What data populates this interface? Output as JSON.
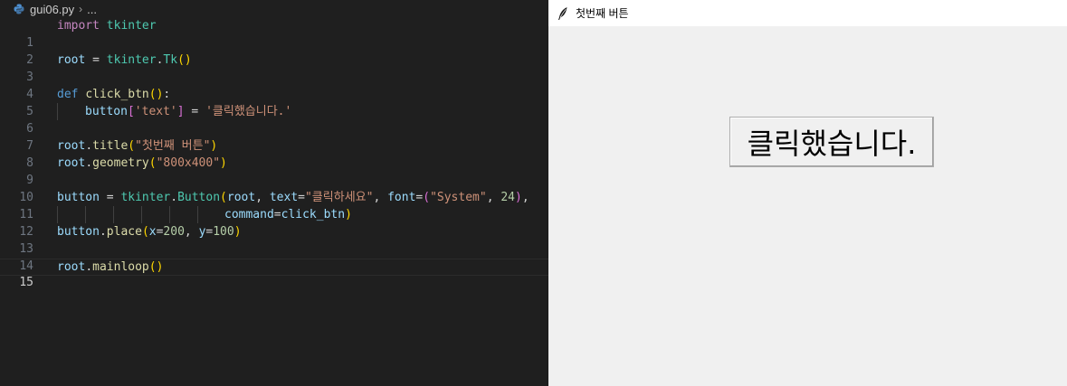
{
  "editor": {
    "breadcrumb": {
      "file": "gui06.py",
      "ellipsis": "..."
    },
    "current_line": 15,
    "line_numbers": [
      "1",
      "2",
      "3",
      "4",
      "5",
      "6",
      "7",
      "8",
      "9",
      "10",
      "11",
      "12",
      "13",
      "14",
      "15"
    ],
    "code": {
      "l1": {
        "kw": "import",
        "mod": "tkinter"
      },
      "l3": {
        "var": "root",
        "eq": " = ",
        "mod": "tkinter",
        "dot": ".",
        "cls": "Tk",
        "p": "()"
      },
      "l5": {
        "kw": "def",
        "fn": "click_btn",
        "p": "()",
        "colon": ":"
      },
      "l6": {
        "var": "button",
        "b1": "[",
        "key": "'text'",
        "b2": "]",
        "eq": " = ",
        "val": "'클릭했습니다.'"
      },
      "l8": {
        "var": "root",
        "dot": ".",
        "fn": "title",
        "p1": "(",
        "str": "\"첫번째 버튼\"",
        "p2": ")"
      },
      "l9": {
        "var": "root",
        "dot": ".",
        "fn": "geometry",
        "p1": "(",
        "str": "\"800x400\"",
        "p2": ")"
      },
      "l11": {
        "var": "button",
        "eq": " = ",
        "mod": "tkinter",
        "dot": ".",
        "cls": "Button",
        "p1": "(",
        "arg": "root",
        "comma": ", ",
        "kw": "text",
        "eqs": "=",
        "str": "\"클릭하세요\"",
        "comma2": ", ",
        "kw2": "font",
        "eqs2": "=",
        "t1": "(",
        "str2": "\"System\"",
        "comma3": ", ",
        "num": "24",
        "t2": ")",
        "comma4": ","
      },
      "l12": {
        "kw": "command",
        "eqs": "=",
        "val": "click_btn",
        "p2": ")"
      },
      "l13": {
        "var": "button",
        "dot": ".",
        "fn": "place",
        "p1": "(",
        "kx": "x",
        "eqs": "=",
        "nx": "200",
        "comma": ", ",
        "ky": "y",
        "eqs2": "=",
        "ny": "100",
        "p2": ")"
      },
      "l15": {
        "var": "root",
        "dot": ".",
        "fn": "mainloop",
        "p": "()"
      }
    }
  },
  "tk_window": {
    "title": "첫번째 버튼",
    "button_label": "클릭했습니다."
  },
  "icons": {
    "breadcrumb": "python-file-icon",
    "titlebar": "tk-feather-icon"
  }
}
